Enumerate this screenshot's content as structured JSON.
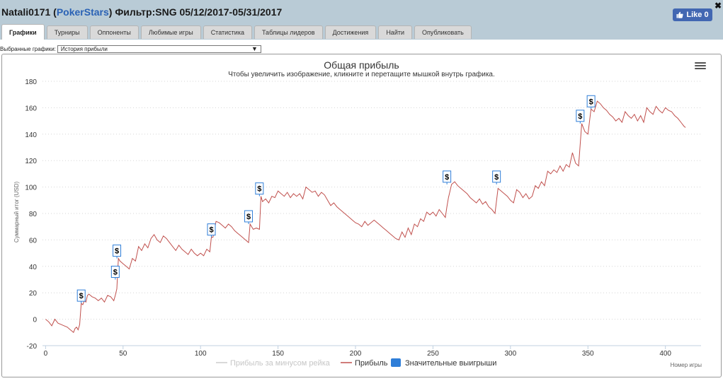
{
  "header": {
    "player": "Natali0171",
    "site": "PokerStars",
    "filter_label": "Фильтр:",
    "filter_value": "SNG 05/12/2017-05/31/2017",
    "fb_like": "Like 0",
    "close": "✖"
  },
  "tabs": [
    {
      "label": "Графики",
      "active": true
    },
    {
      "label": "Турниры"
    },
    {
      "label": "Оппоненты"
    },
    {
      "label": "Любимые игры"
    },
    {
      "label": "Статистика"
    },
    {
      "label": "Таблицы лидеров"
    },
    {
      "label": "Достижения"
    },
    {
      "label": "Найти"
    },
    {
      "label": "Опубликовать"
    }
  ],
  "selector": {
    "label": "Выбранные графики:",
    "value": "История прибыли",
    "arrow": "▼"
  },
  "colors": {
    "header_bg": "#b9cbd6",
    "profit_line": "#c0504d",
    "rake_line": "#cccccc",
    "big_wins": "#2f7ed8",
    "site_link": "#2a62b5"
  },
  "chart_data": {
    "type": "line",
    "title": "Общая прибыль",
    "subtitle": "Чтобы увеличить изображение, кликните и перетащите мышкой внутрь графика.",
    "ylabel": "Суммарный итог (USD)",
    "xlabel": "Номер игры",
    "ylim": [
      -20,
      180
    ],
    "xlim": [
      -2,
      423
    ],
    "yticks": [
      "-20",
      "0",
      "20",
      "40",
      "60",
      "80",
      "100",
      "120",
      "140",
      "160",
      "180"
    ],
    "xticks": [
      "0",
      "50",
      "100",
      "150",
      "200",
      "250",
      "300",
      "350",
      "400"
    ],
    "grid": true,
    "legend": [
      {
        "name": "Прибыль за минусом рейка",
        "color": "#cccccc",
        "symbol": "line",
        "disabled": true
      },
      {
        "name": "Прибыль",
        "color": "#c0504d",
        "symbol": "line"
      },
      {
        "name": "Значительные выигрыши",
        "color": "#2f7ed8",
        "symbol": "square"
      }
    ],
    "series": [
      {
        "name": "Прибыль",
        "points": [
          [
            0,
            0
          ],
          [
            2,
            -2
          ],
          [
            4,
            -5
          ],
          [
            6,
            0
          ],
          [
            8,
            -3
          ],
          [
            10,
            -4
          ],
          [
            12,
            -5
          ],
          [
            14,
            -6
          ],
          [
            16,
            -8
          ],
          [
            17,
            -9
          ],
          [
            18,
            -10
          ],
          [
            19,
            -7
          ],
          [
            20,
            -6
          ],
          [
            21,
            -8
          ],
          [
            22,
            -4
          ],
          [
            23,
            12
          ],
          [
            24,
            11
          ],
          [
            25,
            14
          ],
          [
            26,
            13
          ],
          [
            27,
            18
          ],
          [
            28,
            19
          ],
          [
            30,
            17
          ],
          [
            32,
            16
          ],
          [
            34,
            14
          ],
          [
            36,
            16
          ],
          [
            38,
            13
          ],
          [
            40,
            18
          ],
          [
            42,
            17
          ],
          [
            44,
            14
          ],
          [
            45,
            18
          ],
          [
            46,
            23
          ],
          [
            47,
            46
          ],
          [
            48,
            44
          ],
          [
            50,
            42
          ],
          [
            52,
            40
          ],
          [
            54,
            38
          ],
          [
            56,
            46
          ],
          [
            58,
            44
          ],
          [
            60,
            55
          ],
          [
            62,
            52
          ],
          [
            64,
            57
          ],
          [
            66,
            54
          ],
          [
            68,
            61
          ],
          [
            70,
            64
          ],
          [
            72,
            60
          ],
          [
            74,
            58
          ],
          [
            76,
            63
          ],
          [
            78,
            61
          ],
          [
            80,
            58
          ],
          [
            82,
            55
          ],
          [
            84,
            52
          ],
          [
            86,
            56
          ],
          [
            88,
            53
          ],
          [
            90,
            51
          ],
          [
            92,
            49
          ],
          [
            94,
            53
          ],
          [
            96,
            50
          ],
          [
            98,
            48
          ],
          [
            100,
            50
          ],
          [
            102,
            48
          ],
          [
            104,
            53
          ],
          [
            106,
            51
          ],
          [
            107,
            62
          ],
          [
            108,
            62
          ],
          [
            110,
            74
          ],
          [
            112,
            73
          ],
          [
            114,
            71
          ],
          [
            116,
            69
          ],
          [
            118,
            72
          ],
          [
            120,
            70
          ],
          [
            122,
            67
          ],
          [
            124,
            65
          ],
          [
            126,
            63
          ],
          [
            128,
            61
          ],
          [
            130,
            59
          ],
          [
            131,
            58
          ],
          [
            132,
            72
          ],
          [
            133,
            70
          ],
          [
            134,
            68
          ],
          [
            136,
            69
          ],
          [
            138,
            68
          ],
          [
            139,
            93
          ],
          [
            140,
            89
          ],
          [
            142,
            91
          ],
          [
            144,
            88
          ],
          [
            146,
            93
          ],
          [
            148,
            92
          ],
          [
            150,
            97
          ],
          [
            152,
            95
          ],
          [
            154,
            93
          ],
          [
            156,
            96
          ],
          [
            158,
            92
          ],
          [
            160,
            95
          ],
          [
            162,
            93
          ],
          [
            164,
            95
          ],
          [
            166,
            91
          ],
          [
            168,
            100
          ],
          [
            170,
            98
          ],
          [
            172,
            96
          ],
          [
            174,
            97
          ],
          [
            176,
            93
          ],
          [
            178,
            96
          ],
          [
            180,
            94
          ],
          [
            182,
            90
          ],
          [
            184,
            86
          ],
          [
            186,
            88
          ],
          [
            188,
            85
          ],
          [
            190,
            83
          ],
          [
            192,
            81
          ],
          [
            194,
            79
          ],
          [
            196,
            77
          ],
          [
            198,
            75
          ],
          [
            200,
            73
          ],
          [
            202,
            72
          ],
          [
            204,
            70
          ],
          [
            206,
            74
          ],
          [
            208,
            71
          ],
          [
            210,
            73
          ],
          [
            212,
            75
          ],
          [
            214,
            73
          ],
          [
            216,
            71
          ],
          [
            218,
            69
          ],
          [
            220,
            67
          ],
          [
            222,
            65
          ],
          [
            224,
            63
          ],
          [
            226,
            61
          ],
          [
            228,
            60
          ],
          [
            230,
            66
          ],
          [
            232,
            62
          ],
          [
            234,
            69
          ],
          [
            236,
            64
          ],
          [
            238,
            72
          ],
          [
            240,
            70
          ],
          [
            242,
            76
          ],
          [
            244,
            74
          ],
          [
            246,
            81
          ],
          [
            248,
            79
          ],
          [
            250,
            81
          ],
          [
            252,
            78
          ],
          [
            254,
            83
          ],
          [
            256,
            80
          ],
          [
            258,
            77
          ],
          [
            259,
            85
          ],
          [
            260,
            92
          ],
          [
            262,
            102
          ],
          [
            264,
            104
          ],
          [
            266,
            101
          ],
          [
            268,
            99
          ],
          [
            270,
            97
          ],
          [
            272,
            95
          ],
          [
            274,
            92
          ],
          [
            276,
            90
          ],
          [
            278,
            88
          ],
          [
            280,
            91
          ],
          [
            282,
            87
          ],
          [
            284,
            89
          ],
          [
            286,
            85
          ],
          [
            288,
            83
          ],
          [
            290,
            80
          ],
          [
            292,
            99
          ],
          [
            294,
            97
          ],
          [
            296,
            95
          ],
          [
            298,
            93
          ],
          [
            300,
            90
          ],
          [
            302,
            88
          ],
          [
            304,
            98
          ],
          [
            306,
            96
          ],
          [
            308,
            92
          ],
          [
            310,
            95
          ],
          [
            312,
            91
          ],
          [
            314,
            93
          ],
          [
            316,
            101
          ],
          [
            318,
            99
          ],
          [
            320,
            104
          ],
          [
            322,
            101
          ],
          [
            324,
            112
          ],
          [
            326,
            110
          ],
          [
            328,
            113
          ],
          [
            330,
            111
          ],
          [
            332,
            116
          ],
          [
            334,
            112
          ],
          [
            336,
            117
          ],
          [
            338,
            115
          ],
          [
            340,
            126
          ],
          [
            342,
            118
          ],
          [
            344,
            116
          ],
          [
            346,
            148
          ],
          [
            348,
            142
          ],
          [
            350,
            140
          ],
          [
            352,
            159
          ],
          [
            354,
            157
          ],
          [
            356,
            165
          ],
          [
            358,
            163
          ],
          [
            360,
            160
          ],
          [
            362,
            158
          ],
          [
            364,
            155
          ],
          [
            366,
            153
          ],
          [
            368,
            150
          ],
          [
            370,
            152
          ],
          [
            372,
            149
          ],
          [
            374,
            157
          ],
          [
            376,
            154
          ],
          [
            378,
            152
          ],
          [
            380,
            155
          ],
          [
            382,
            150
          ],
          [
            384,
            154
          ],
          [
            386,
            149
          ],
          [
            388,
            160
          ],
          [
            390,
            157
          ],
          [
            392,
            155
          ],
          [
            394,
            161
          ],
          [
            396,
            158
          ],
          [
            398,
            156
          ],
          [
            400,
            160
          ],
          [
            402,
            158
          ],
          [
            404,
            157
          ],
          [
            406,
            154
          ],
          [
            408,
            152
          ],
          [
            410,
            149
          ],
          [
            412,
            146
          ],
          [
            413,
            145
          ]
        ]
      }
    ],
    "big_win_markers": [
      {
        "game": 23,
        "value": 12,
        "label": "$"
      },
      {
        "game": 45,
        "value": 30,
        "label": "$"
      },
      {
        "game": 46,
        "value": 46,
        "label": "$"
      },
      {
        "game": 107,
        "value": 62,
        "label": "$"
      },
      {
        "game": 131,
        "value": 72,
        "label": "$"
      },
      {
        "game": 138,
        "value": 93,
        "label": "$"
      },
      {
        "game": 259,
        "value": 102,
        "label": "$"
      },
      {
        "game": 291,
        "value": 102,
        "label": "$"
      },
      {
        "game": 345,
        "value": 148,
        "label": "$"
      },
      {
        "game": 352,
        "value": 159,
        "label": "$"
      }
    ]
  }
}
